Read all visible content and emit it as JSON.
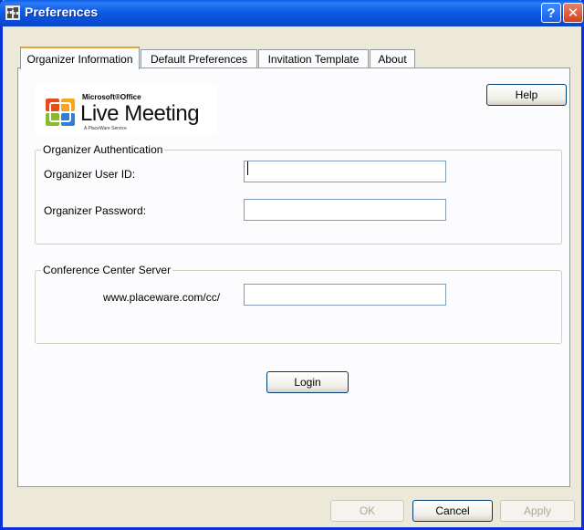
{
  "window": {
    "title": "Preferences",
    "help_glyph": "?",
    "close_glyph": "✕"
  },
  "tabs": [
    {
      "label": "Organizer Information",
      "active": true
    },
    {
      "label": "Default Preferences",
      "active": false
    },
    {
      "label": "Invitation Template",
      "active": false
    },
    {
      "label": "About",
      "active": false
    }
  ],
  "logo": {
    "line1": "Microsoft®Office",
    "line2": "Live Meeting",
    "line3": "A PlaceWare Service"
  },
  "help_button": "Help",
  "auth": {
    "legend": "Organizer Authentication",
    "user_id_label": "Organizer User ID:",
    "user_id_value": "",
    "password_label": "Organizer Password:",
    "password_value": ""
  },
  "server": {
    "legend": "Conference Center Server",
    "url_prefix": "www.placeware.com/cc/",
    "value": ""
  },
  "login_button": "Login",
  "footer": {
    "ok": "OK",
    "cancel": "Cancel",
    "apply": "Apply"
  },
  "colors": {
    "titlebar": "#0a4fd7",
    "window_bg": "#ece9d8",
    "tab_highlight": "#e8a33c"
  }
}
